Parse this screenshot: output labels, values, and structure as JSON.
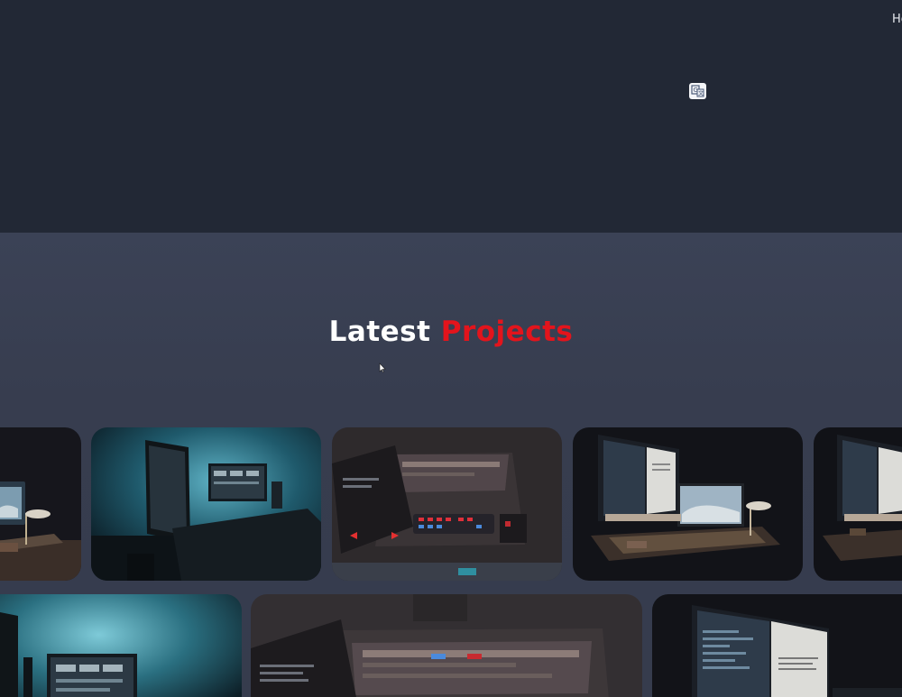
{
  "nav": {
    "home_label": "Home"
  },
  "hero": {
    "translate_icon": "translate-icon"
  },
  "projects": {
    "title_part1": "Latest",
    "title_part2": "Projects",
    "row1": [
      {
        "name": "project-card-1",
        "scene": "desk-monitor-lamp"
      },
      {
        "name": "project-card-2",
        "scene": "teal-desk-setup"
      },
      {
        "name": "project-card-3",
        "scene": "laptop-red-keyboard"
      },
      {
        "name": "project-card-4",
        "scene": "imac-desk-lamp"
      },
      {
        "name": "project-card-5",
        "scene": "imac-desk"
      }
    ],
    "row2": [
      {
        "name": "project-card-6",
        "scene": "teal-desk-setup"
      },
      {
        "name": "project-card-7",
        "scene": "laptop-top-view"
      },
      {
        "name": "project-card-8",
        "scene": "monitor-code"
      }
    ]
  },
  "colors": {
    "hero_bg": "#222835",
    "section_bg": "#373d4f",
    "accent": "#e3141c",
    "title_text": "#ffffff"
  }
}
